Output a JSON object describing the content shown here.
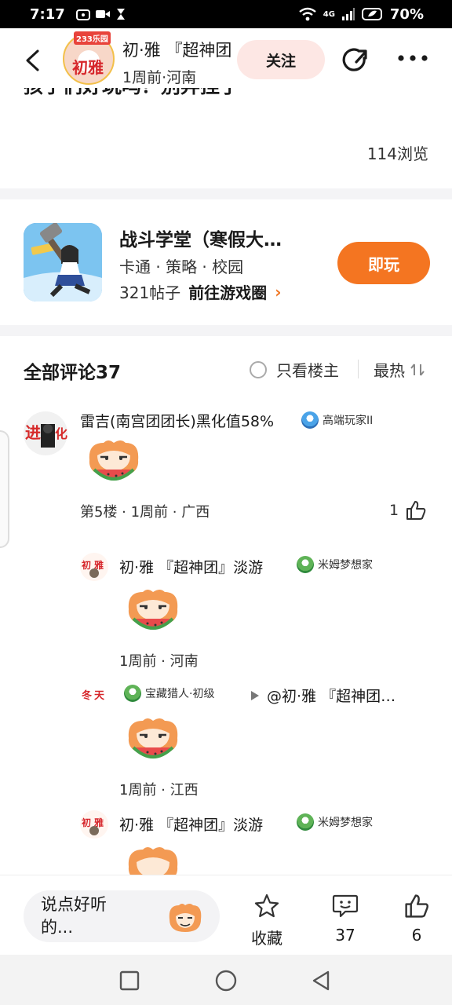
{
  "status_bar": {
    "time": "7:17",
    "network": "4G",
    "battery": "70%"
  },
  "header": {
    "author_name": "初·雅 『超神团』淡游",
    "author_meta": "1周前·河南",
    "avatar_text": "初雅",
    "avatar_tag": "233乐园",
    "follow_label": "关注"
  },
  "post": {
    "cut_text": "孩子们好玩吗？别弃挂了",
    "views": "114浏览"
  },
  "game_card": {
    "title": "战斗学堂（寒假大…",
    "tags": "卡通 · 策略 · 校园",
    "posts": "321帖子",
    "goto_label": "前往游戏圈",
    "goto_arrow": "›",
    "play_label": "即玩"
  },
  "comments": {
    "title": "全部评论37",
    "only_op_label": "只看楼主",
    "sort_label": "最热",
    "items": [
      {
        "name": "雷吉(南宫团团长)黑化值58%",
        "badge": "高端玩家II",
        "meta": "第5楼 · 1周前 · 广西",
        "likes": "1"
      }
    ],
    "replies": [
      {
        "name": "初·雅 『超神团』淡游",
        "badge": "米姆梦想家",
        "meta": "1周前 · 河南"
      },
      {
        "badge": "宝藏猎人·初级",
        "reply_to": "@初·雅 『超神团…",
        "meta": "1周前 · 江西"
      },
      {
        "name": "初·雅 『超神团』淡游",
        "badge": "米姆梦想家"
      }
    ]
  },
  "bottom_bar": {
    "input_placeholder": "说点好听的...",
    "favorite_label": "收藏",
    "comment_count": "37",
    "like_count": "6"
  },
  "colors": {
    "accent": "#f47521",
    "follow_bg": "#fde7e4",
    "divider": "#f4f4f6"
  }
}
